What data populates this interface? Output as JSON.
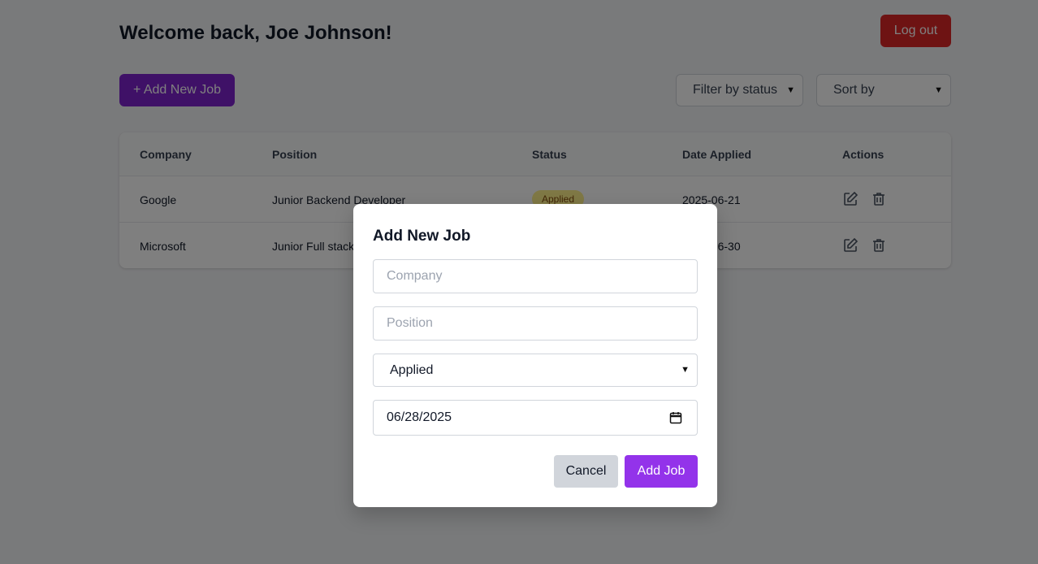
{
  "header": {
    "welcome": "Welcome back, Joe Johnson!",
    "logout_label": "Log out"
  },
  "toolbar": {
    "add_job_label": "+ Add New Job",
    "filter_label": "Filter by status",
    "sort_label": "Sort by"
  },
  "table": {
    "columns": [
      "Company",
      "Position",
      "Status",
      "Date Applied",
      "Actions"
    ],
    "rows": [
      {
        "company": "Google",
        "position": "Junior Backend Developer",
        "status": "Applied",
        "date": "2025-06-21"
      },
      {
        "company": "Microsoft",
        "position": "Junior Full stack",
        "status": "",
        "date": "2025-06-30"
      }
    ]
  },
  "modal": {
    "title": "Add New Job",
    "company_placeholder": "Company",
    "position_placeholder": "Position",
    "status_value": "Applied",
    "date_value": "06/28/2025",
    "cancel_label": "Cancel",
    "submit_label": "Add Job"
  },
  "colors": {
    "logout": "#dc2626",
    "add_job": "#7e22ce",
    "submit": "#9333ea",
    "badge_applied": "#fef08a"
  }
}
